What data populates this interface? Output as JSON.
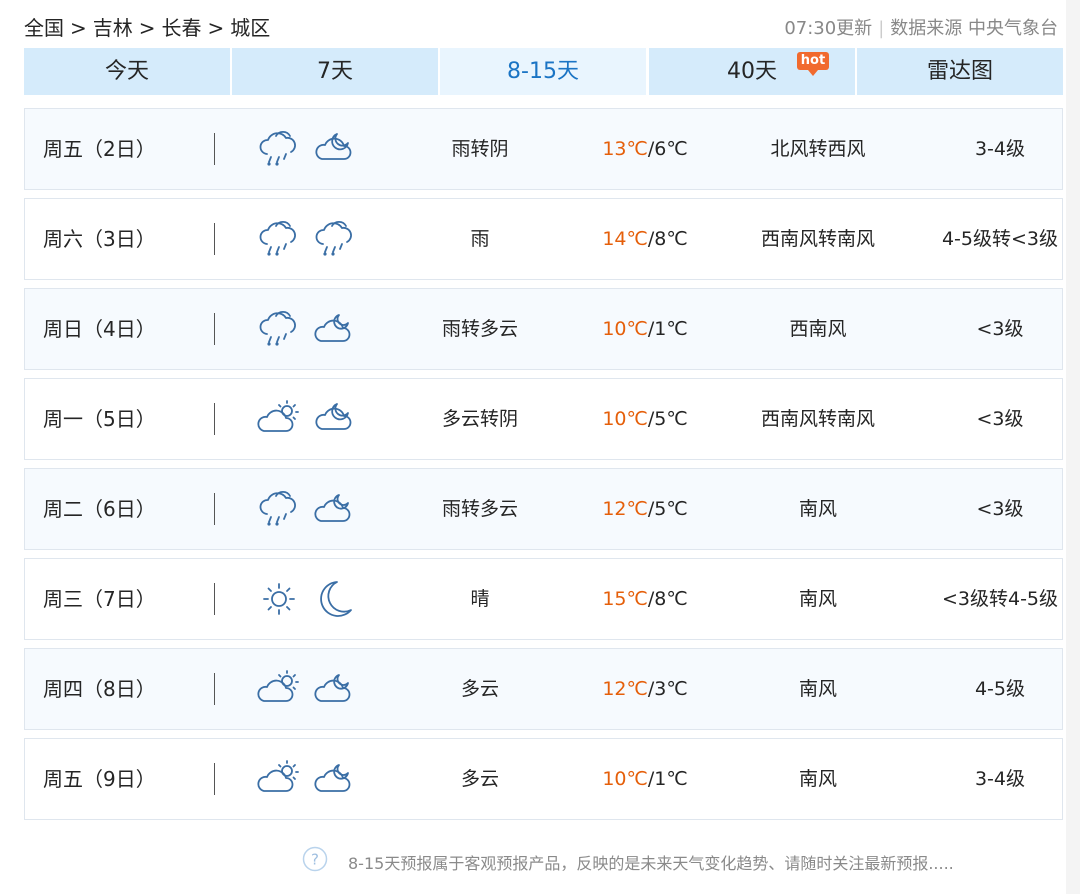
{
  "breadcrumb": {
    "items": [
      "全国",
      "吉林",
      "长春",
      "城区"
    ],
    "separator": ">"
  },
  "meta": {
    "update": "07:30更新",
    "source": "数据来源 中央气象台"
  },
  "tabs": [
    {
      "label": "今天",
      "active": false
    },
    {
      "label": "7天",
      "active": false
    },
    {
      "label": "8-15天",
      "active": true
    },
    {
      "label": "40天",
      "active": false,
      "badge": "hot"
    },
    {
      "label": "雷达图",
      "active": false
    }
  ],
  "forecast": [
    {
      "day": "周五（2日）",
      "icon_day": "rain-cloud-icon",
      "icon_night": "overcast-moon-icon",
      "condition": "雨转阴",
      "high": "13℃",
      "low": "6℃",
      "wind": "北风转西风",
      "level": "3-4级"
    },
    {
      "day": "周六（3日）",
      "icon_day": "rain-cloud-icon",
      "icon_night": "rain-cloud-icon",
      "condition": "雨",
      "high": "14℃",
      "low": "8℃",
      "wind": "西南风转南风",
      "level": "4-5级转<3级"
    },
    {
      "day": "周日（4日）",
      "icon_day": "rain-cloud-icon",
      "icon_night": "cloudy-moon-icon",
      "condition": "雨转多云",
      "high": "10℃",
      "low": "1℃",
      "wind": "西南风",
      "level": "<3级"
    },
    {
      "day": "周一（5日）",
      "icon_day": "cloudy-sun-icon",
      "icon_night": "overcast-moon-icon",
      "condition": "多云转阴",
      "high": "10℃",
      "low": "5℃",
      "wind": "西南风转南风",
      "level": "<3级"
    },
    {
      "day": "周二（6日）",
      "icon_day": "rain-cloud-icon",
      "icon_night": "cloudy-moon-icon",
      "condition": "雨转多云",
      "high": "12℃",
      "low": "5℃",
      "wind": "南风",
      "level": "<3级"
    },
    {
      "day": "周三（7日）",
      "icon_day": "sun-icon",
      "icon_night": "moon-icon",
      "condition": "晴",
      "high": "15℃",
      "low": "8℃",
      "wind": "南风",
      "level": "<3级转4-5级"
    },
    {
      "day": "周四（8日）",
      "icon_day": "cloudy-sun-icon",
      "icon_night": "cloudy-moon-icon",
      "condition": "多云",
      "high": "12℃",
      "low": "3℃",
      "wind": "南风",
      "level": "4-5级"
    },
    {
      "day": "周五（9日）",
      "icon_day": "cloudy-sun-icon",
      "icon_night": "cloudy-moon-icon",
      "condition": "多云",
      "high": "10℃",
      "low": "1℃",
      "wind": "南风",
      "level": "3-4级"
    }
  ],
  "note": {
    "icon": "question-icon",
    "text": "8-15天预报属于客观预报产品，反映的是未来天气变化趋势、请随时关注最新预报....."
  },
  "colors": {
    "tab_bg": "#d5ebfb",
    "tab_active_bg": "#e9f5fe",
    "tab_active_text": "#1a74c4",
    "high_temp": "#e55f0a",
    "hot_badge": "#f16a2e"
  }
}
